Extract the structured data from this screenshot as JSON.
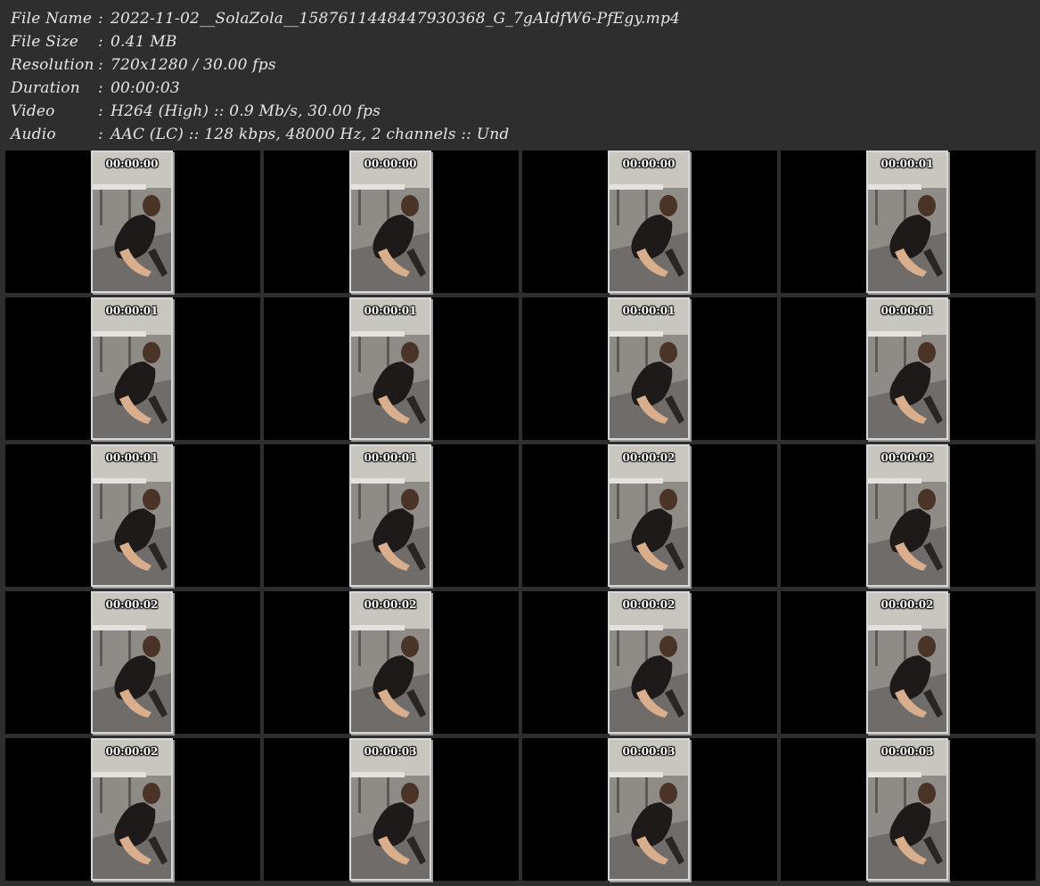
{
  "info": [
    {
      "label": "File Name",
      "value": "2022-11-02__SolaZola__1587611448447930368_G_7gAIdfW6-PfEgy.mp4"
    },
    {
      "label": "File Size",
      "value": "0.41 MB"
    },
    {
      "label": "Resolution",
      "value": "720x1280 / 30.00 fps"
    },
    {
      "label": "Duration",
      "value": "00:00:03"
    },
    {
      "label": "Video",
      "value": "H264 (High) :: 0.9 Mb/s, 30.00 fps"
    },
    {
      "label": "Audio",
      "value": "AAC (LC) :: 128 kbps, 48000 Hz, 2 channels :: Und"
    }
  ],
  "separator": ":",
  "thumbnails": [
    "00:00:00",
    "00:00:00",
    "00:00:00",
    "00:00:01",
    "00:00:01",
    "00:00:01",
    "00:00:01",
    "00:00:01",
    "00:00:01",
    "00:00:01",
    "00:00:02",
    "00:00:02",
    "00:00:02",
    "00:00:02",
    "00:00:02",
    "00:00:02",
    "00:00:02",
    "00:00:03",
    "00:00:03",
    "00:00:03"
  ],
  "grid": {
    "columns": 4,
    "rows": 5
  },
  "colors": {
    "background": "#2e2e2e",
    "cell": "#000000",
    "text": "#e6e6e6",
    "frame_border": "#d8d8d8"
  }
}
